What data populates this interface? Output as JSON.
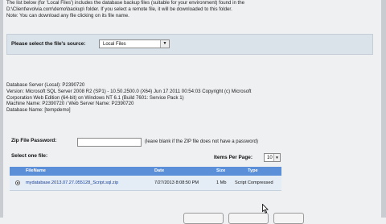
{
  "intro": {
    "line1": "The list below (for 'Local Files') includes the database backup files (suitable for your environment) found in the",
    "line2": "D:\\Client\\evolvia.com\\demo\\backup\\ folder.  If you select a remote file, it will be downloaded to this folder.",
    "line3": "Note: You can download any file clicking on its file name."
  },
  "source": {
    "label": "Please select the file's source:",
    "selected": "Local Files"
  },
  "server_info": {
    "line1": "Database Server (Local): P2390720",
    "line2": "Version: Microsoft SQL Server 2008 R2 (SP1) - 10.50.2500.0 (X64) Jun 17 2011 00:54:03 Copyright (c) Microsoft",
    "line3": "Corporation Web Edition (64-bit) on Windows NT 6.1 (Build 7601: Service Pack 1)",
    "line4": "Machine Name: P2390720 / Web Server Name: P2390720",
    "line5": "Database Name: [tempdemo]"
  },
  "zip": {
    "label": "Zip File Password:",
    "value": "",
    "note": "(leave blank if the ZIP file does not have a password)"
  },
  "select_label": "Select one file:",
  "items_per_page": {
    "label": "Items Per Page:",
    "value": "10"
  },
  "table": {
    "headers": [
      "FileName",
      "Date",
      "Size",
      "Type"
    ],
    "rows": [
      {
        "filename": "mydatabase.2013.07.27.055128_Script.sql.zip",
        "date": "7/27/2013 8:08:50 PM",
        "size": "1 Mb",
        "type": "Script Compressed"
      }
    ]
  },
  "colors": {
    "table_header": "#5b8fd8",
    "panel": "#dbe3ea"
  }
}
